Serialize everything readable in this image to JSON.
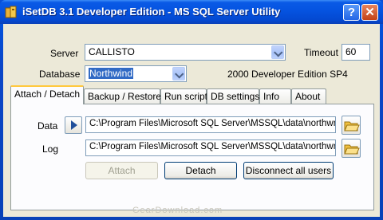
{
  "window": {
    "title": "iSetDB 3.1 Developer Edition - MS SQL Server Utility",
    "help_glyph": "?",
    "close_glyph": "✕"
  },
  "server": {
    "label": "Server",
    "value": "CALLISTO"
  },
  "timeout": {
    "label": "Timeout",
    "value": "60"
  },
  "database": {
    "label": "Database",
    "value": "Northwind"
  },
  "edition_text": "2000 Developer Edition SP4",
  "tabs": [
    {
      "label": "Attach / Detach"
    },
    {
      "label": "Backup / Restore"
    },
    {
      "label": "Run script"
    },
    {
      "label": "DB settings"
    },
    {
      "label": "Info"
    },
    {
      "label": "About"
    }
  ],
  "attach": {
    "data_label": "Data",
    "data_path": "C:\\Program Files\\Microsoft SQL Server\\MSSQL\\data\\northwnd.",
    "log_label": "Log",
    "log_path": "C:\\Program Files\\Microsoft SQL Server\\MSSQL\\data\\northwnd.l",
    "attach_label": "Attach",
    "detach_label": "Detach",
    "disconnect_label": "Disconnect all users"
  },
  "watermark": "GearDownload.com",
  "colors": {
    "titlebar": "#0553e0",
    "face": "#ece9d8",
    "selection": "#316ac5",
    "active_tab_accent": "#ffc83c"
  }
}
